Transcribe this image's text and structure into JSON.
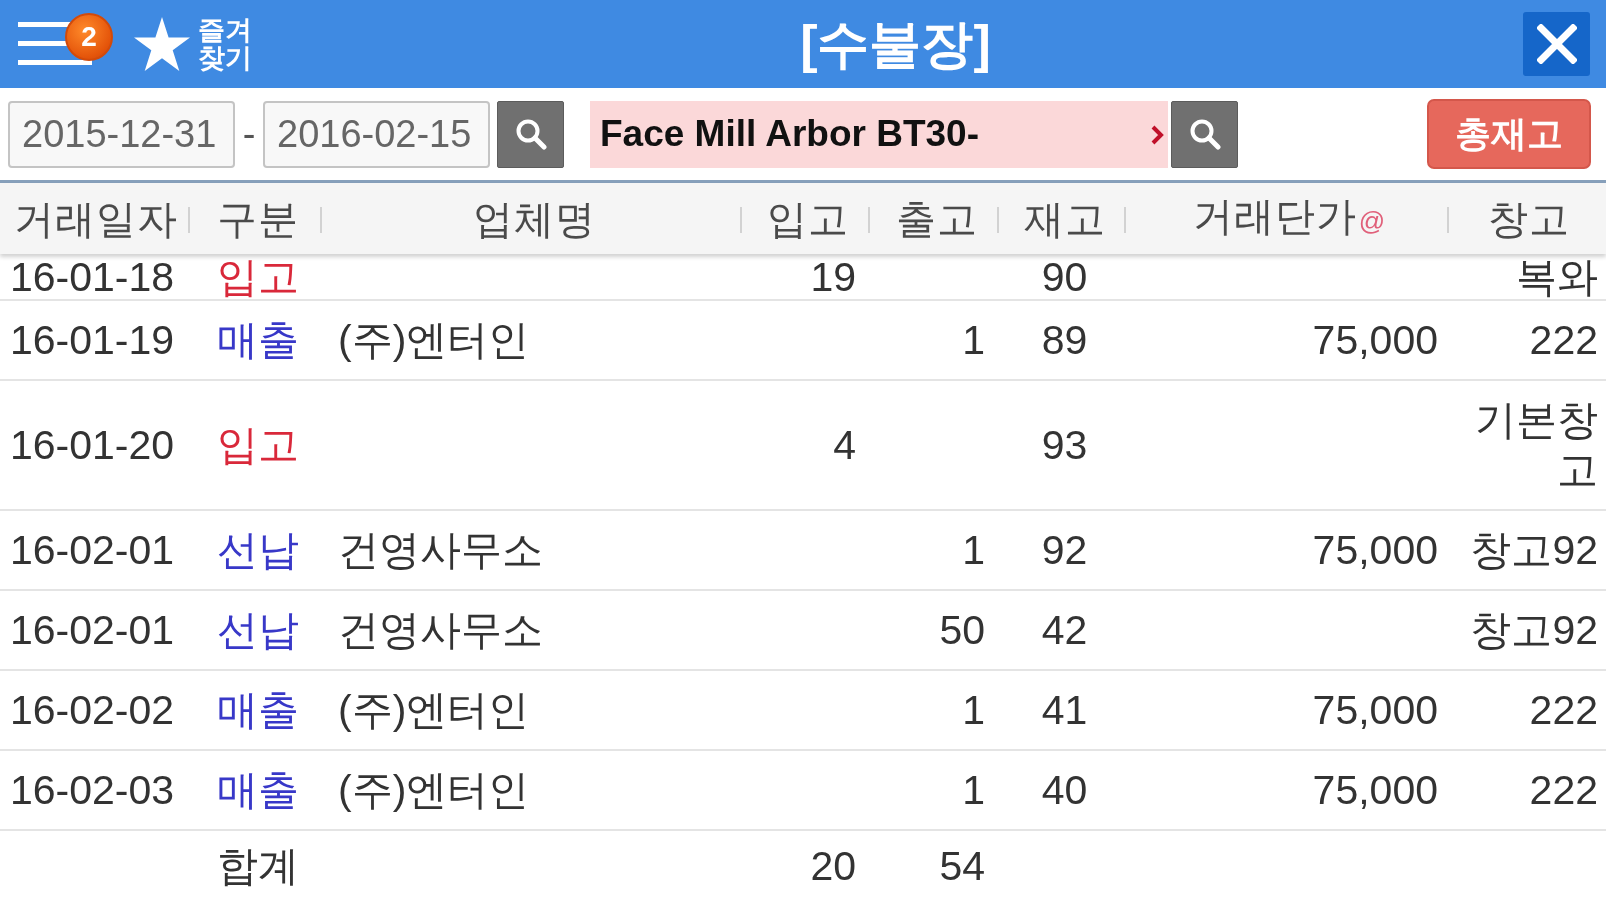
{
  "title_bar": {
    "menu_badge": "2",
    "favorites_label": "즐겨찾기",
    "title": "[수불장]"
  },
  "filter_bar": {
    "date_from": "2015-12-31",
    "date_separator": "-",
    "date_to": "2016-02-15",
    "item_search": "Face Mill Arbor BT30-",
    "total_stock_button": "총재고"
  },
  "table": {
    "columns": [
      {
        "label": "거래일자"
      },
      {
        "label": "구분"
      },
      {
        "label": "업체명"
      },
      {
        "label": "입고"
      },
      {
        "label": "출고"
      },
      {
        "label": "재고"
      },
      {
        "label": "거래단가",
        "suffix": "@"
      },
      {
        "label": "창고"
      }
    ],
    "rows": [
      {
        "partial": true,
        "date": "16-01-18",
        "type": {
          "label": "입고",
          "color": "#d9283a"
        },
        "in": "19",
        "stock": "90",
        "warehouse": "복와"
      },
      {
        "partial": false,
        "date": "16-01-19",
        "type": {
          "label": "매출",
          "color": "#3838c8"
        },
        "company": "(주)엔터인",
        "out": "1",
        "stock": "89",
        "price": "75,000",
        "warehouse": "222"
      },
      {
        "partial": false,
        "date": "16-01-20",
        "type": {
          "label": "입고",
          "color": "#d9283a"
        },
        "in": "4",
        "stock": "93",
        "warehouse": "기본창고"
      },
      {
        "partial": false,
        "date": "16-02-01",
        "type": {
          "label": "선납",
          "color": "#3838c8"
        },
        "company": "건영사무소",
        "out": "1",
        "stock": "92",
        "price": "75,000",
        "warehouse": "창고92"
      },
      {
        "partial": false,
        "date": "16-02-01",
        "type": {
          "label": "선납",
          "color": "#3838c8"
        },
        "company": "건영사무소",
        "out": "50",
        "stock": "42",
        "warehouse": "창고92"
      },
      {
        "partial": false,
        "date": "16-02-02",
        "type": {
          "label": "매출",
          "color": "#3838c8"
        },
        "company": "(주)엔터인",
        "out": "1",
        "stock": "41",
        "price": "75,000",
        "warehouse": "222"
      },
      {
        "partial": false,
        "date": "16-02-03",
        "type": {
          "label": "매출",
          "color": "#3838c8"
        },
        "company": "(주)엔터인",
        "out": "1",
        "stock": "40",
        "price": "75,000",
        "warehouse": "222"
      }
    ],
    "totals": {
      "label": "합계",
      "in": "20",
      "out": "54"
    }
  }
}
